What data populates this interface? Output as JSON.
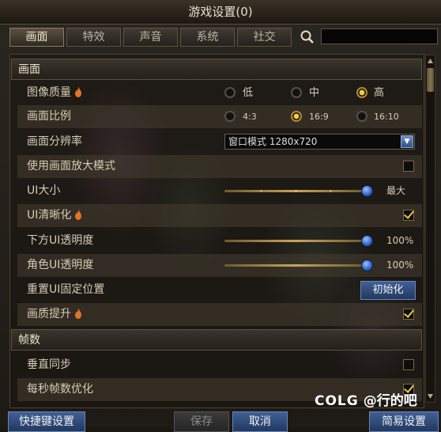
{
  "window": {
    "title": "游戏设置(0)"
  },
  "tabs": [
    {
      "label": "画面",
      "active": true
    },
    {
      "label": "特效",
      "active": false
    },
    {
      "label": "声音",
      "active": false
    },
    {
      "label": "系统",
      "active": false
    },
    {
      "label": "社交",
      "active": false
    }
  ],
  "search": {
    "icon": "search-icon",
    "value": ""
  },
  "sections": {
    "display": {
      "header": "画面"
    },
    "framerate": {
      "header": "帧数"
    }
  },
  "settings": {
    "image_quality": {
      "label": "图像质量",
      "icon": "flame-icon",
      "options": [
        "低",
        "中",
        "高"
      ],
      "selected": "高"
    },
    "aspect_ratio": {
      "label": "画面比例",
      "options": [
        "4:3",
        "16:9",
        "16:10"
      ],
      "selected": "16:9"
    },
    "resolution": {
      "label": "画面分辨率",
      "value": "窗口模式 1280x720",
      "dropdown_icon": "chevron-down-icon"
    },
    "zoom_mode": {
      "label": "使用画面放大模式",
      "checked": false
    },
    "ui_size": {
      "label": "UI大小",
      "value_text": "最大",
      "value": 1.0
    },
    "ui_clarity": {
      "label": "UI清晰化",
      "icon": "flame-icon",
      "checked": true
    },
    "bottom_ui_opacity": {
      "label": "下方UI透明度",
      "value_text": "100%",
      "value": 1.0
    },
    "character_ui_opacity": {
      "label": "角色UI透明度",
      "value_text": "100%",
      "value": 1.0
    },
    "reset_ui_position": {
      "label": "重置UI固定位置",
      "button_label": "初始化"
    },
    "quality_boost": {
      "label": "画质提升",
      "icon": "flame-icon",
      "checked": true
    },
    "vsync": {
      "label": "垂直同步",
      "checked": false
    },
    "fps_optimize": {
      "label": "每秒帧数优化",
      "checked": true
    }
  },
  "footer": {
    "shortcut_label": "快捷键设置",
    "save_label": "保存",
    "cancel_label": "取消",
    "simple_label": "简易设置"
  },
  "watermark": {
    "logo": "COLG",
    "text": "@行的吧"
  },
  "colors": {
    "accent_gold": "#f2c24a",
    "button_blue": "#2f4f8a",
    "slider_blue": "#2c62c8"
  }
}
